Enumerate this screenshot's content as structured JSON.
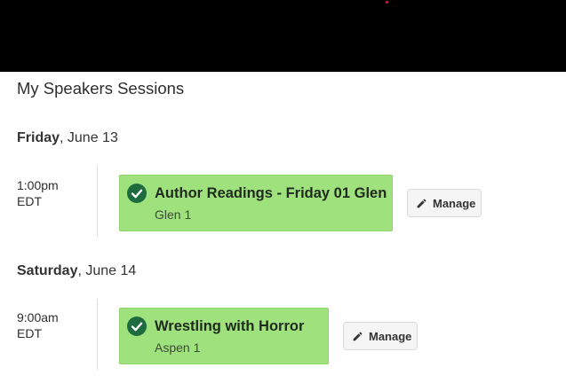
{
  "page": {
    "title": "My Speakers Sessions"
  },
  "days": [
    {
      "weekday": "Friday",
      "date": ", June 13",
      "sessions": [
        {
          "time": "1:00pm",
          "tz": "EDT",
          "title": "Author Readings - Friday 01 Glen",
          "room": "Glen 1",
          "action": "Manage"
        }
      ]
    },
    {
      "weekday": "Saturday",
      "date": ", June 14",
      "sessions": [
        {
          "time": "9:00am",
          "tz": "EDT",
          "title": "Wrestling with Horror",
          "room": "Aspen 1",
          "action": "Manage"
        }
      ]
    }
  ],
  "colors": {
    "card": "#9fe17d",
    "check": "#1e6b3f",
    "banner": "#000000"
  },
  "icons": {
    "status": "check-circle-icon",
    "manage": "pencil-icon"
  }
}
